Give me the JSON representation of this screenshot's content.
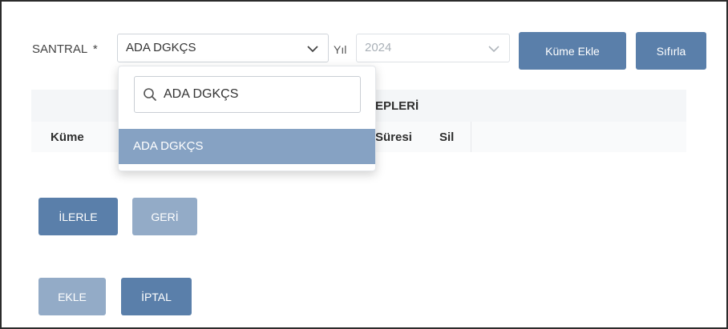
{
  "filters": {
    "santral_label": "SANTRAL",
    "santral_required_mark": "*",
    "santral_value": "ADA DGKÇS",
    "yil_label": "Yıl",
    "yil_value": "2024"
  },
  "buttons": {
    "kume_ekle": "Küme Ekle",
    "sifirla": "Sıfırla",
    "ilerle": "İLERLE",
    "geri": "GERİ",
    "ekle": "EKLE",
    "iptal": "İPTAL"
  },
  "table": {
    "title_partial": "EPLERİ",
    "columns": {
      "kume": "Küme",
      "suresi_partial": "Süresi",
      "sil": "Sil"
    }
  },
  "dropdown": {
    "search_value": "ADA DGKÇS",
    "options": [
      "ADA DGKÇS"
    ],
    "highlighted_option": "ADA DGKÇS"
  },
  "colors": {
    "primary_button": "#5a7faa",
    "disabled_button": "#93abc7",
    "option_highlight": "#86a2c3"
  },
  "icons": {
    "santral_chevron": "chevron-down-icon",
    "yil_chevron": "chevron-down-icon",
    "search": "search-icon"
  }
}
